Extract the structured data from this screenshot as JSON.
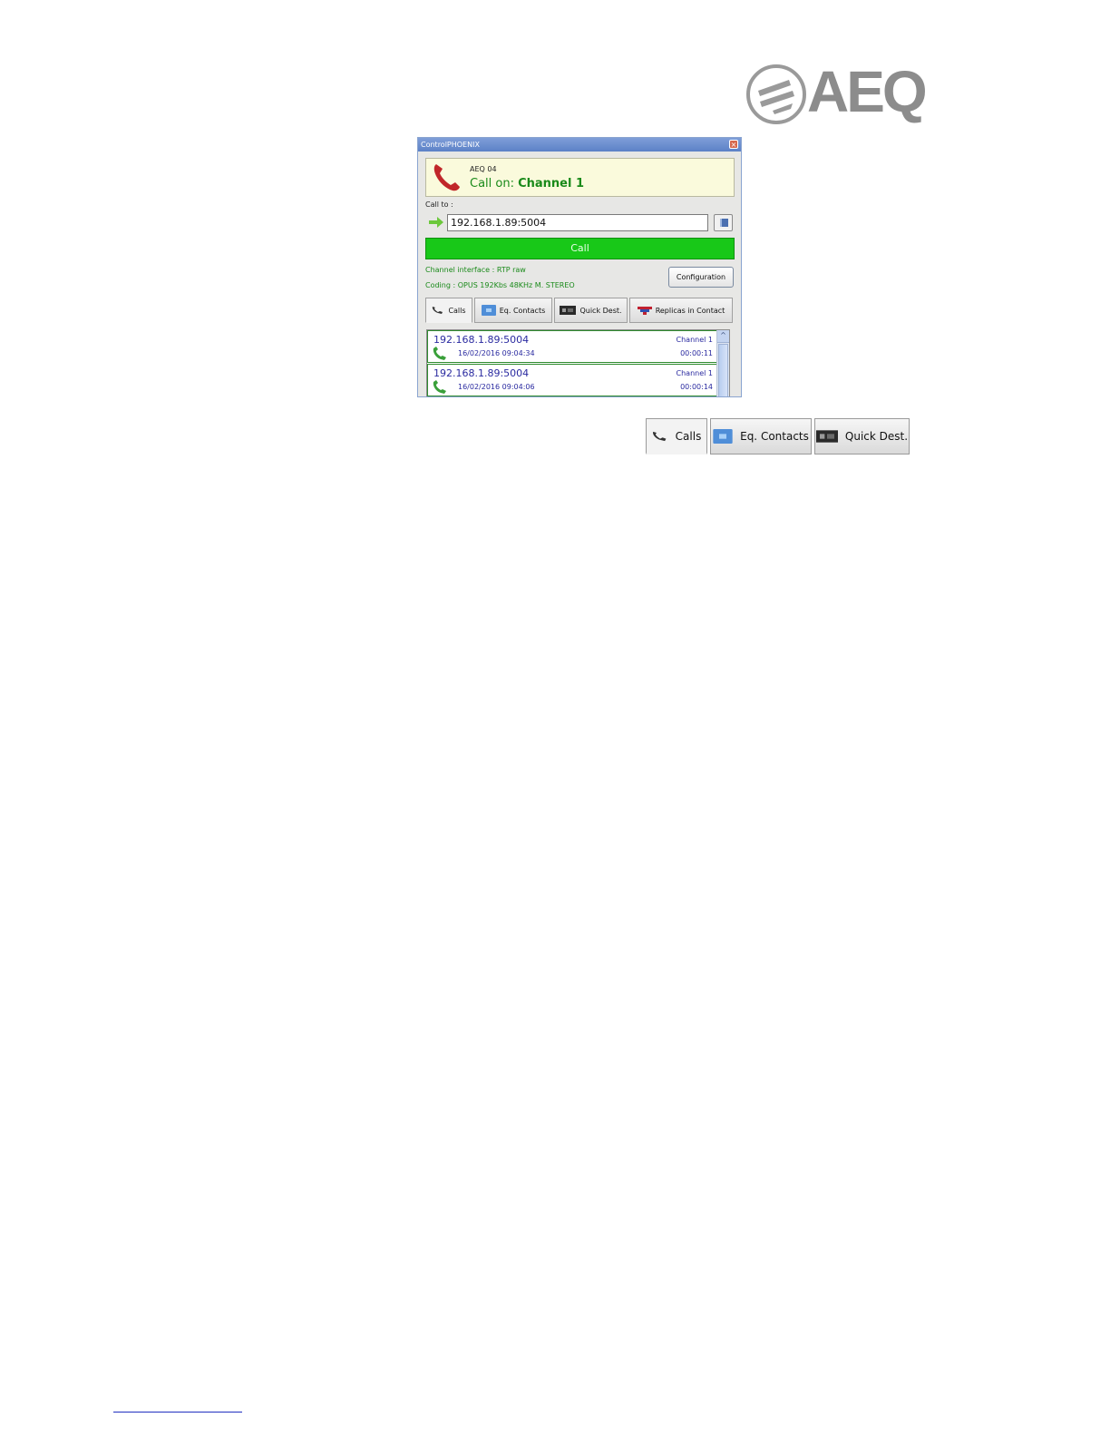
{
  "logo": {
    "text": "AEQ"
  },
  "window": {
    "title": "ControlPHOENIX",
    "status": {
      "device": "AEQ 04",
      "call_prefix": "Call on: ",
      "channel": "Channel 1"
    },
    "call_to_label": "Call to :",
    "address_value": "192.168.1.89:5004",
    "call_button": "Call",
    "channel_interface": "Channel interface : RTP raw",
    "coding": "Coding : OPUS 192Kbs 48KHz M. STEREO",
    "configuration_button": "Configuration",
    "tabs": [
      {
        "label": "Calls",
        "icon": "phone-icon"
      },
      {
        "label": "Eq. Contacts",
        "icon": "contacts-icon"
      },
      {
        "label": "Quick Dest.",
        "icon": "device-icon"
      },
      {
        "label": "Replicas in Contact",
        "icon": "replicas-icon"
      }
    ],
    "calls": [
      {
        "address": "192.168.1.89:5004",
        "date": "16/02/2016 09:04:34",
        "channel": "Channel 1",
        "duration": "00:00:11"
      },
      {
        "address": "192.168.1.89:5004",
        "date": "16/02/2016 09:04:06",
        "channel": "Channel 1",
        "duration": "00:00:14"
      }
    ]
  },
  "enlarged_tabs": [
    {
      "label": "Calls"
    },
    {
      "label": "Eq. Contacts"
    },
    {
      "label": "Quick Dest."
    }
  ],
  "colors": {
    "call_green": "#18c818",
    "status_green": "#1a8a1a",
    "link_blue": "#2a2aa0"
  }
}
